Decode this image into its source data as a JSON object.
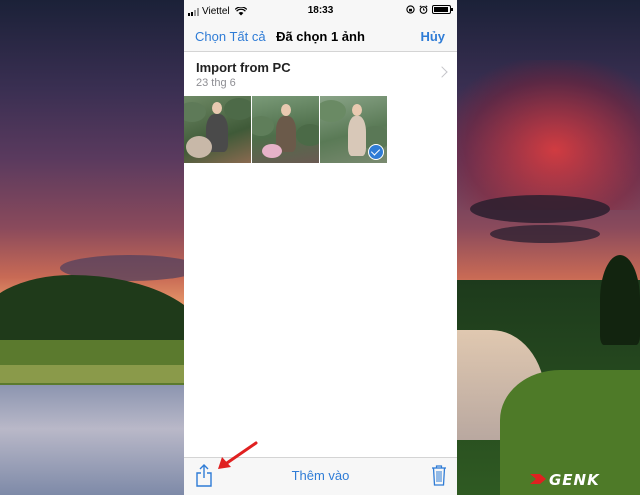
{
  "status_bar": {
    "carrier": "Viettel",
    "time": "18:33"
  },
  "nav": {
    "select_all": "Chọn Tất cả",
    "title": "Đã chọn 1 ảnh",
    "cancel": "Hủy"
  },
  "album": {
    "title": "Import from PC",
    "date": "23 thg 6"
  },
  "photos": [
    {
      "selected": false
    },
    {
      "selected": false
    },
    {
      "selected": true
    }
  ],
  "toolbar": {
    "add_to": "Thêm vào"
  },
  "icons": {
    "share": "share-icon",
    "trash": "trash-icon",
    "chevron": "chevron-right-icon"
  },
  "colors": {
    "accent": "#2f7cd6",
    "arrow": "#e02020"
  },
  "watermark": {
    "brand": "GENK"
  }
}
